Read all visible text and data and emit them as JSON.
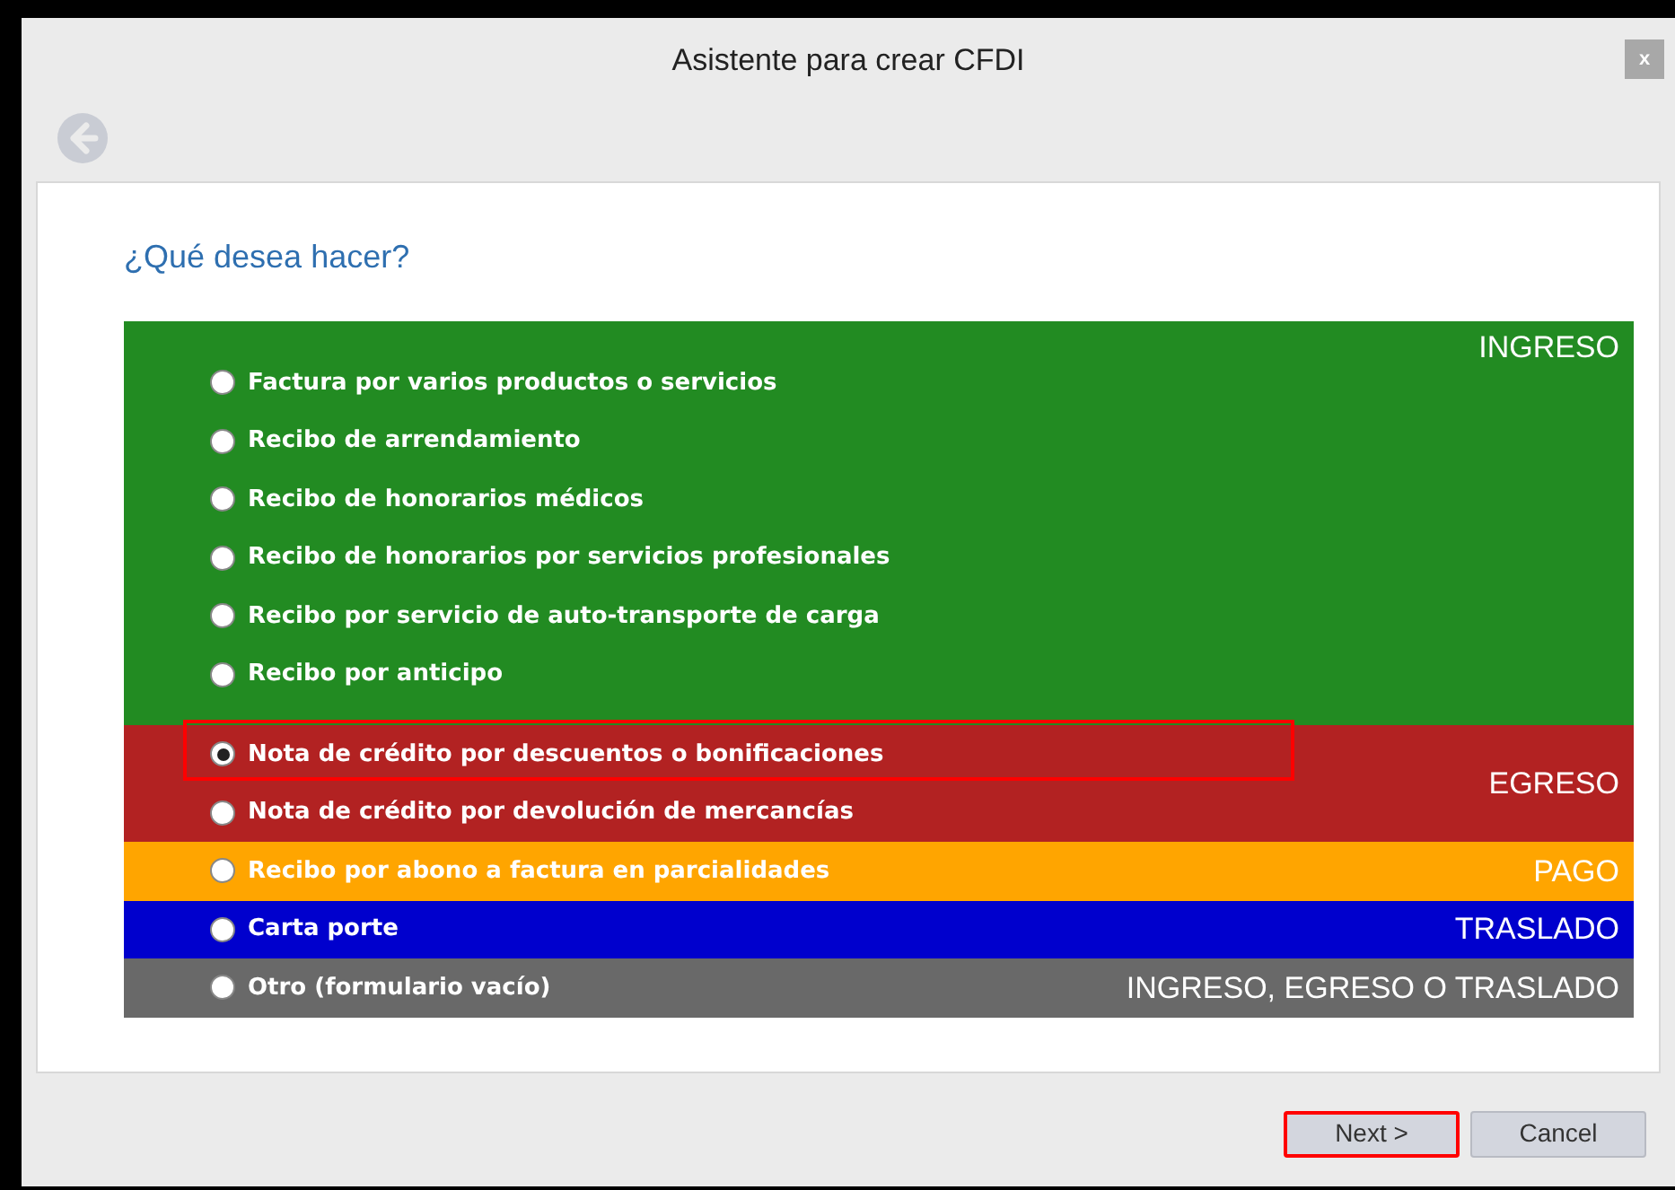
{
  "window": {
    "title": "Asistente para crear CFDI",
    "close": "x"
  },
  "question": "¿Qué desea hacer?",
  "groups": [
    {
      "label": "INGRESO",
      "color": "#228b22",
      "options": [
        {
          "text": "Factura por varios productos o servicios",
          "selected": false,
          "highlighted": false
        },
        {
          "text": "Recibo de arrendamiento",
          "selected": false,
          "highlighted": false
        },
        {
          "text": "Recibo de honorarios médicos",
          "selected": false,
          "highlighted": false
        },
        {
          "text": "Recibo de honorarios por servicios profesionales",
          "selected": false,
          "highlighted": false
        },
        {
          "text": "Recibo por servicio de auto-transporte de carga",
          "selected": false,
          "highlighted": false
        },
        {
          "text": "Recibo por anticipo",
          "selected": false,
          "highlighted": false
        }
      ]
    },
    {
      "label": "EGRESO",
      "color": "#b22222",
      "options": [
        {
          "text": "Nota de crédito por descuentos o bonificaciones",
          "selected": true,
          "highlighted": true
        },
        {
          "text": "Nota de crédito por devolución de mercancías",
          "selected": false,
          "highlighted": false
        }
      ]
    },
    {
      "label": "PAGO",
      "color": "#ffa500",
      "options": [
        {
          "text": "Recibo por abono a factura en parcialidades",
          "selected": false,
          "highlighted": false
        }
      ]
    },
    {
      "label": "TRASLADO",
      "color": "#0000cd",
      "options": [
        {
          "text": "Carta porte",
          "selected": false,
          "highlighted": false
        }
      ]
    },
    {
      "label": "INGRESO, EGRESO O TRASLADO",
      "color": "#696969",
      "options": [
        {
          "text": "Otro (formulario vacío)",
          "selected": false,
          "highlighted": false
        }
      ]
    }
  ],
  "buttons": [
    {
      "label": "Next >",
      "highlighted": true
    },
    {
      "label": "Cancel",
      "highlighted": false
    }
  ]
}
